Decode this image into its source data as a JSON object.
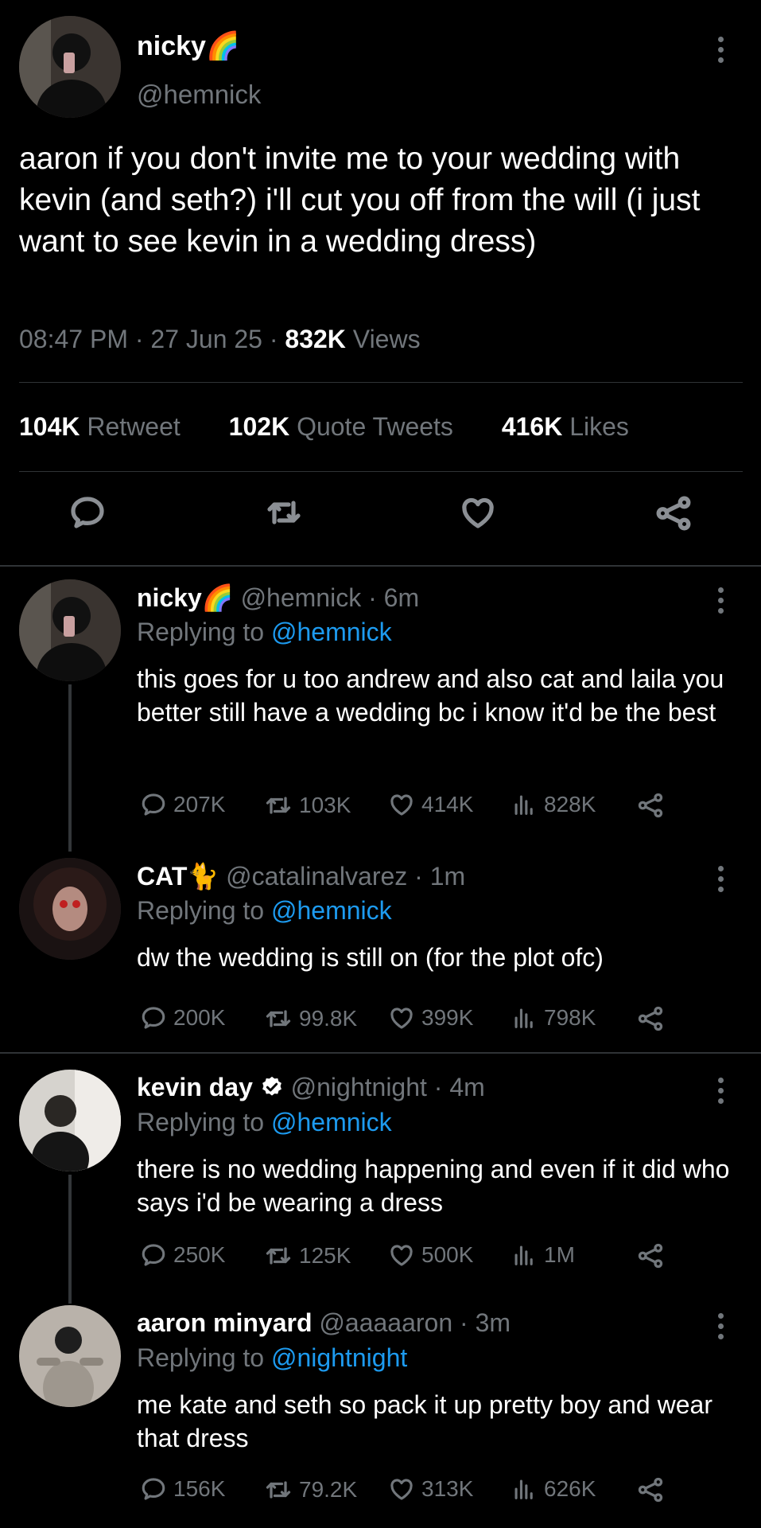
{
  "main_tweet": {
    "author_name": "nicky",
    "author_emoji": "🌈",
    "handle": "@hemnick",
    "text": "aaron if you don't invite me to your wedding with kevin (and seth?) i'll cut you off from the will (i just want to see kevin in a wedding dress)",
    "time": "08:47 PM",
    "date": "27 Jun 25",
    "views_count": "832K",
    "views_label": "Views",
    "retweets_count": "104K",
    "retweets_label": "Retweet",
    "quotes_count": "102K",
    "quotes_label": "Quote Tweets",
    "likes_count": "416K",
    "likes_label": "Likes"
  },
  "replies": [
    {
      "name": "nicky",
      "emoji": "🌈",
      "handle": "@hemnick",
      "age": "6m",
      "replying_label": "Replying to",
      "replying_to": "@hemnick",
      "text": "this goes for u too andrew and also cat and laila you better still have a wedding bc i know it'd be the best",
      "comments": "207K",
      "retweets": "103K",
      "likes": "414K",
      "views": "828K"
    },
    {
      "name": "CAT",
      "emoji": "🐈",
      "handle": "@catalinalvarez",
      "age": "1m",
      "replying_label": "Replying to",
      "replying_to": "@hemnick",
      "text": "dw the wedding is still on (for the plot ofc)",
      "comments": "200K",
      "retweets": "99.8K",
      "likes": "399K",
      "views": "798K"
    },
    {
      "name": "kevin day",
      "emoji": "",
      "handle": "@nightnight",
      "age": "4m",
      "replying_label": "Replying to",
      "replying_to": "@hemnick",
      "text": "there is no wedding happening and even if it did who says i'd be wearing a dress",
      "comments": "250K",
      "retweets": "125K",
      "likes": "500K",
      "views": "1M"
    },
    {
      "name": "aaron minyard",
      "emoji": "",
      "handle": "@aaaaaron",
      "age": "3m",
      "replying_label": "Replying to",
      "replying_to": "@nightnight",
      "text": "me kate and seth so pack it up pretty boy and wear that dress",
      "comments": "156K",
      "retweets": "79.2K",
      "likes": "313K",
      "views": "626K"
    }
  ],
  "colors": {
    "background": "#000000",
    "text": "#ffffff",
    "secondary": "#71767b",
    "link": "#1d9bf0",
    "divider": "#2f3336",
    "verified": "#ffffff"
  }
}
